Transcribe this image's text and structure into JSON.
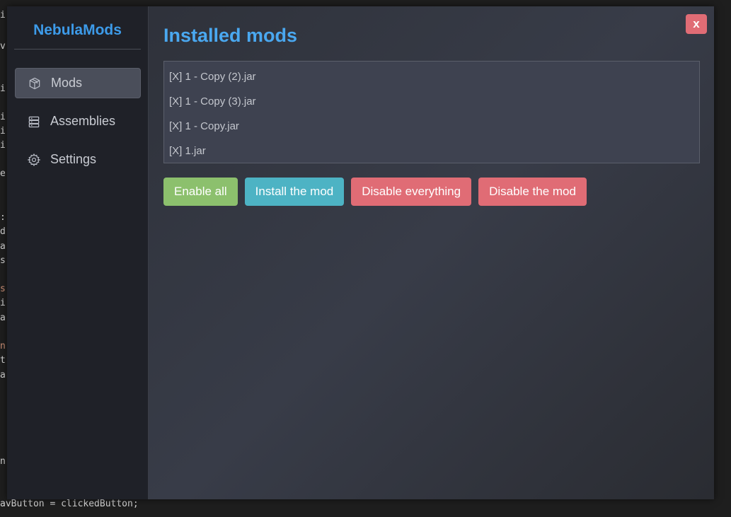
{
  "app": {
    "brand": "NebulaMods"
  },
  "sidebar": {
    "items": [
      {
        "label": "Mods",
        "icon": "box-icon",
        "active": true
      },
      {
        "label": "Assemblies",
        "icon": "stack-icon",
        "active": false
      },
      {
        "label": "Settings",
        "icon": "gear-icon",
        "active": false
      }
    ]
  },
  "main": {
    "title": "Installed mods",
    "close_label": "x",
    "mods": [
      "[X] 1 - Copy (2).jar",
      "[X] 1 - Copy (3).jar",
      "[X] 1 - Copy.jar",
      "[X] 1.jar"
    ],
    "actions": {
      "enable_all": "Enable all",
      "install": "Install the mod",
      "disable_everything": "Disable everything",
      "disable_mod": "Disable the mod"
    }
  },
  "background_code": {
    "chars": [
      "i",
      "v",
      "i",
      "i",
      "i",
      "i",
      "e",
      ":",
      "d",
      "a",
      "s",
      "s",
      "i",
      "a",
      "n",
      "t",
      "a",
      "n"
    ],
    "bottom_line": "avButton = clickedButton;"
  },
  "colors": {
    "accent": "#3d9be9",
    "success": "#8cc06d",
    "info": "#4db3c4",
    "danger": "#e06c75"
  }
}
